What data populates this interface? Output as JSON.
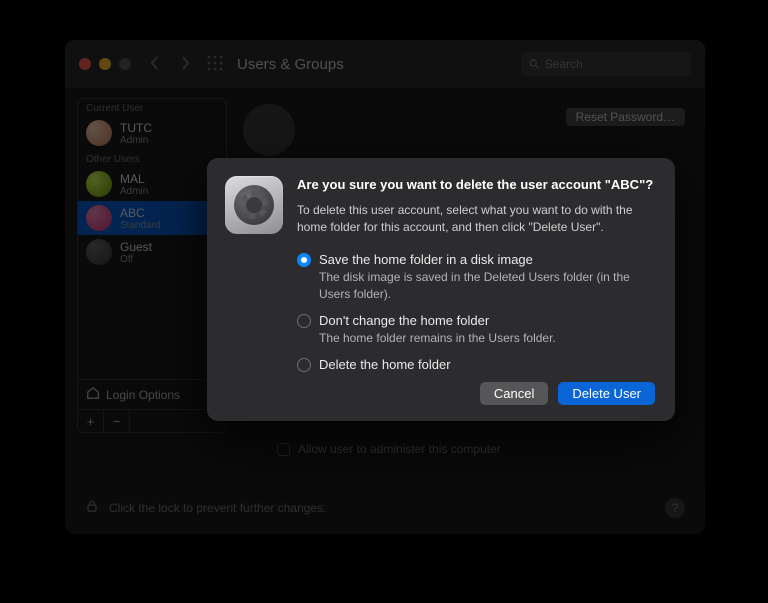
{
  "window": {
    "title": "Users & Groups",
    "search_placeholder": "Search"
  },
  "sidebar": {
    "current_hdr": "Current User",
    "other_hdr": "Other Users",
    "users": [
      {
        "name": "TUTC",
        "role": "Admin"
      },
      {
        "name": "MAL",
        "role": "Admin"
      },
      {
        "name": "ABC",
        "role": "Standard"
      },
      {
        "name": "Guest",
        "role": "Off"
      }
    ],
    "login_options": "Login Options"
  },
  "main": {
    "reset_label": "Reset Password…",
    "admin_label": "Allow user to administer this computer"
  },
  "footer": {
    "lock_text": "Click the lock to prevent further changes.",
    "help": "?"
  },
  "dialog": {
    "title": "Are you sure you want to delete the user account \"ABC\"?",
    "desc": "To delete this user account, select what you want to do with the home folder for this account, and then click \"Delete User\".",
    "options": [
      {
        "label": "Save the home folder in a disk image",
        "sub": "The disk image is saved in the Deleted Users folder (in the Users folder).",
        "selected": true
      },
      {
        "label": "Don't change the home folder",
        "sub": "The home folder remains in the Users folder.",
        "selected": false
      },
      {
        "label": "Delete the home folder",
        "sub": "",
        "selected": false
      }
    ],
    "cancel": "Cancel",
    "confirm": "Delete User"
  }
}
